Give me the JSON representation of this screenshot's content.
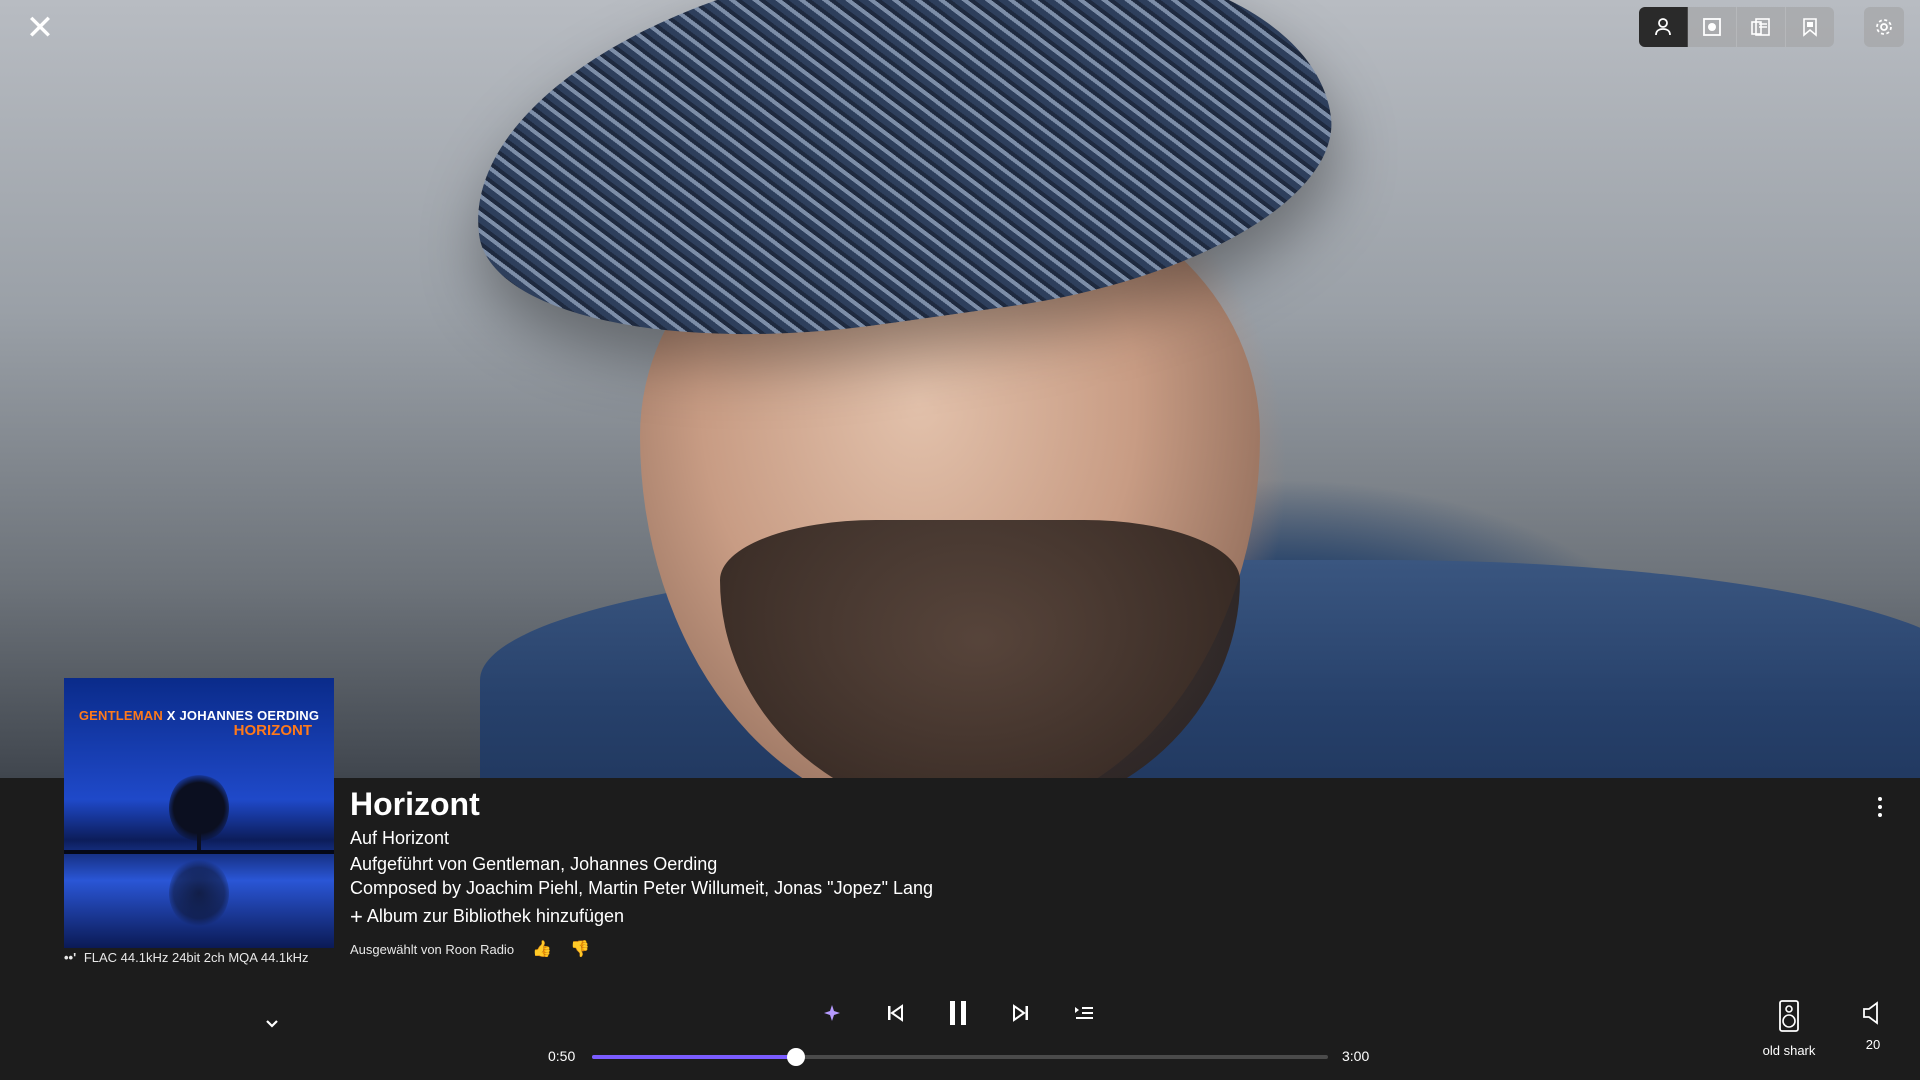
{
  "top_toolbar": {
    "buttons": [
      "artist-view",
      "album-view",
      "lyrics-view",
      "credits-view"
    ],
    "active": "artist-view"
  },
  "album_cover": {
    "artist_line_part1": "GENTLEMAN",
    "artist_line_part2": "X JOHANNES OERDING",
    "album_title": "HORIZONT"
  },
  "format": {
    "badge": "••'",
    "text": "FLAC 44.1kHz 24bit 2ch MQA 44.1kHz"
  },
  "track": {
    "title": "Horizont",
    "album_line": "Auf Horizont",
    "performed_line": "Aufgeführt von Gentleman, Johannes Oerding",
    "composed_line": "Composed by Joachim Piehl, Martin Peter Willumeit, Jonas \"Jopez\" Lang",
    "add_to_library": "Album zur Bibliothek hinzufügen",
    "selected_by": "Ausgewählt von Roon Radio"
  },
  "playback": {
    "current_time": "0:50",
    "total_time": "3:00",
    "progress_fraction": 0.2778,
    "state": "playing"
  },
  "zone": {
    "output_name": "old shark",
    "volume": "20"
  },
  "colors": {
    "accent": "#7a5cff",
    "panel_bg": "#1c1c1c",
    "cover_orange": "#ff7a1a"
  }
}
